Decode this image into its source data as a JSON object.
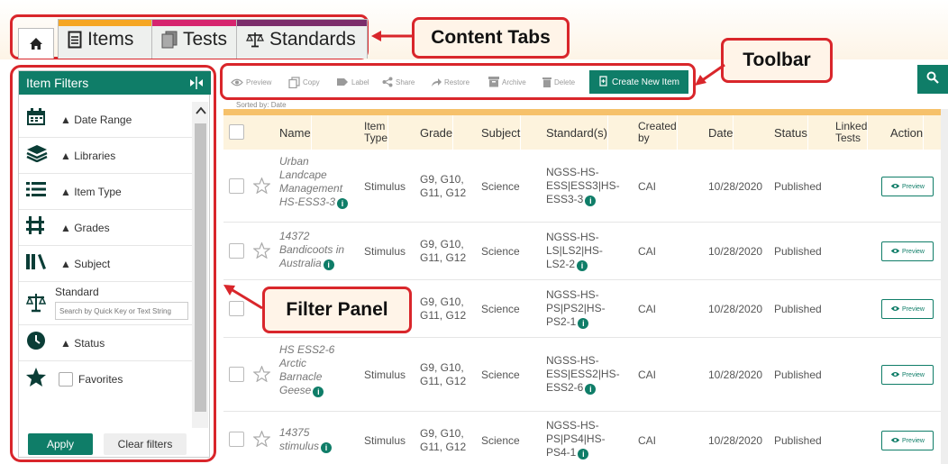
{
  "tabs": [
    {
      "id": "home",
      "icon": "home-icon"
    },
    {
      "id": "items",
      "label": "Items",
      "icon": "document-icon",
      "color": "#f5a623"
    },
    {
      "id": "tests",
      "label": "Tests",
      "icon": "tests-icon",
      "color": "#d6246e"
    },
    {
      "id": "standards",
      "label": "Standards",
      "icon": "scales-icon",
      "color": "#7b2d6b"
    }
  ],
  "callouts": {
    "content_tabs": "Content Tabs",
    "toolbar": "Toolbar",
    "filter_panel": "Filter Panel"
  },
  "filter_panel": {
    "title": "Item Filters",
    "filters": [
      {
        "label": "▲ Date Range",
        "icon": "calendar-icon"
      },
      {
        "label": "▲ Libraries",
        "icon": "libraries-icon"
      },
      {
        "label": "▲ Item Type",
        "icon": "list-icon"
      },
      {
        "label": "▲ Grades",
        "icon": "grades-icon"
      },
      {
        "label": "▲ Subject",
        "icon": "books-icon"
      }
    ],
    "standard_label": "Standard",
    "standard_placeholder": "Search by Quick Key or Text String",
    "status_label": "▲ Status",
    "favorites_label": "Favorites",
    "apply_label": "Apply",
    "clear_label": "Clear filters"
  },
  "toolbar": {
    "preview": "Preview",
    "copy": "Copy",
    "label": "Label",
    "share": "Share",
    "restore": "Restore",
    "archive": "Archive",
    "delete": "Delete",
    "create": "Create New Item"
  },
  "table": {
    "sorted_by": "Sorted by: Date",
    "headers": {
      "name": "Name",
      "item_type_1": "Item",
      "item_type_2": "Type",
      "grade": "Grade",
      "subject": "Subject",
      "standards": "Standard(s)",
      "created_1": "Created",
      "created_2": "by",
      "date": "Date",
      "status": "Status",
      "linked_1": "Linked",
      "linked_2": "Tests",
      "action": "Action"
    },
    "preview_label": "Preview",
    "rows": [
      {
        "name": [
          "Urban",
          "Landcape",
          "Management",
          "HS-ESS3-3"
        ],
        "type": "Stimulus",
        "grade": [
          "G9, G10,",
          "G11, G12"
        ],
        "subject": "Science",
        "standards": [
          "NGSS-HS-",
          "ESS|ESS3|HS-",
          "ESS3-3"
        ],
        "created_by": "CAI",
        "date": "10/28/2020",
        "status": "Published"
      },
      {
        "name": [
          "14372",
          "Bandicoots in",
          "Australia"
        ],
        "type": "Stimulus",
        "grade": [
          "G9, G10,",
          "G11, G12"
        ],
        "subject": "Science",
        "standards": [
          "NGSS-HS-",
          "LS|LS2|HS-",
          "LS2-2"
        ],
        "created_by": "CAI",
        "date": "10/28/2020",
        "status": "Published"
      },
      {
        "name": [],
        "type": "",
        "grade": [
          "G9, G10,",
          "G11, G12"
        ],
        "subject": "Science",
        "standards": [
          "NGSS-HS-",
          "PS|PS2|HS-",
          "PS2-1"
        ],
        "created_by": "CAI",
        "date": "10/28/2020",
        "status": "Published"
      },
      {
        "name": [
          "HS ESS2-6",
          "Arctic",
          "Barnacle",
          "Geese"
        ],
        "type": "Stimulus",
        "grade": [
          "G9, G10,",
          "G11, G12"
        ],
        "subject": "Science",
        "standards": [
          "NGSS-HS-",
          "ESS|ESS2|HS-",
          "ESS2-6"
        ],
        "created_by": "CAI",
        "date": "10/28/2020",
        "status": "Published"
      },
      {
        "name": [
          "14375",
          "stimulus"
        ],
        "type": "Stimulus",
        "grade": [
          "G9, G10,",
          "G11, G12"
        ],
        "subject": "Science",
        "standards": [
          "NGSS-HS-",
          "PS|PS4|HS-",
          "PS4-1"
        ],
        "created_by": "CAI",
        "date": "10/28/2020",
        "status": "Published"
      }
    ]
  },
  "colors": {
    "accent": "#0f7d68",
    "callout_border": "#d9262b",
    "header_bar": "#f6c16a"
  }
}
